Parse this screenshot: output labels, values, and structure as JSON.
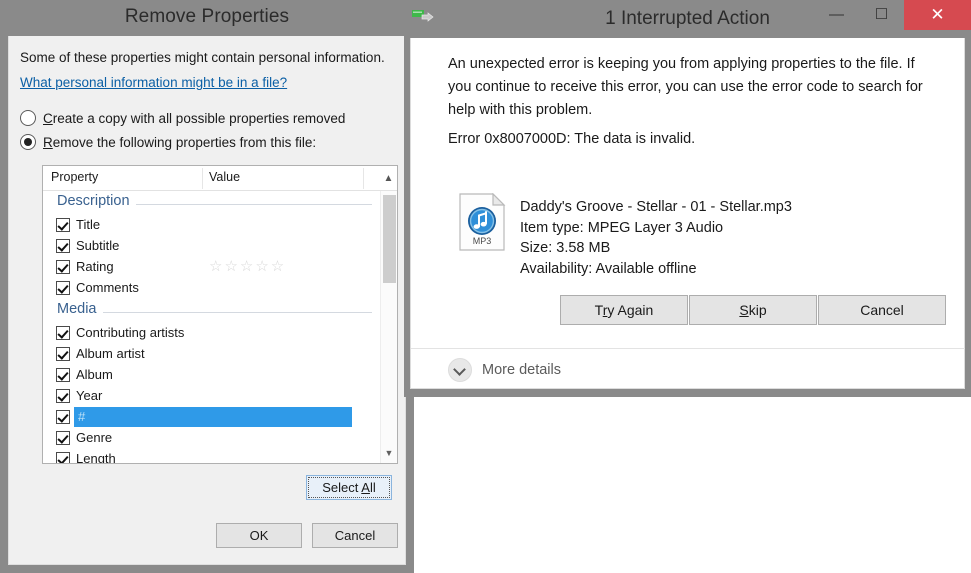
{
  "colors": {
    "titlebar": "#8a8a8a",
    "close_button": "#d64a50",
    "selection": "#2f9ae8",
    "link": "#0b5fa5",
    "group_header": "#39618f",
    "dialog_face": "#f0f0f0"
  },
  "remove_properties_dialog": {
    "title": "Remove Properties",
    "intro": "Some of these properties might contain personal information.",
    "link": "What personal information might be in a file?",
    "options": [
      {
        "label": "Create a copy with all possible properties removed",
        "mnemonic": "C",
        "checked": false
      },
      {
        "label": "Remove the following properties from this file:",
        "mnemonic": "R",
        "checked": true
      }
    ],
    "list": {
      "columns": [
        "Property",
        "Value"
      ],
      "sort_icon": "chevron-up-icon",
      "groups": [
        {
          "name": "Description",
          "rows": [
            {
              "label": "Title",
              "checked": true,
              "value": "",
              "selected": false
            },
            {
              "label": "Subtitle",
              "checked": true,
              "value": "",
              "selected": false
            },
            {
              "label": "Rating",
              "checked": true,
              "value": "☆☆☆☆☆",
              "selected": false
            },
            {
              "label": "Comments",
              "checked": true,
              "value": "",
              "selected": false
            }
          ]
        },
        {
          "name": "Media",
          "rows": [
            {
              "label": "Contributing artists",
              "checked": true,
              "value": "",
              "selected": false
            },
            {
              "label": "Album artist",
              "checked": true,
              "value": "",
              "selected": false
            },
            {
              "label": "Album",
              "checked": true,
              "value": "",
              "selected": false
            },
            {
              "label": "Year",
              "checked": true,
              "value": "",
              "selected": false
            },
            {
              "label": "#",
              "checked": true,
              "value": "",
              "selected": true
            },
            {
              "label": "Genre",
              "checked": true,
              "value": "",
              "selected": false
            },
            {
              "label": "Length",
              "checked": true,
              "value": "",
              "selected": false
            }
          ]
        }
      ],
      "scrollbar": {
        "up_arrow": "⌃",
        "down_arrow": "⌄"
      }
    },
    "buttons": {
      "select_all": {
        "label": "Select All",
        "mnemonic": "A",
        "focused": true
      },
      "ok": "OK",
      "cancel": "Cancel"
    }
  },
  "interrupted_action_dialog": {
    "title": "1 Interrupted Action",
    "app_icon": "file-copy-icon",
    "window_controls": {
      "minimize": "—",
      "maximize": "☐",
      "close": "✕"
    },
    "message": "An unexpected error is keeping you from applying properties to the file. If you continue to receive this error, you can use the error code to search for help with this problem.",
    "error_code": "Error 0x8007000D: The data is invalid.",
    "file": {
      "icon": "mp3-file-icon",
      "icon_label": "MP3",
      "name": "Daddy's Groove - Stellar - 01 - Stellar.mp3",
      "item_type": "Item type: MPEG Layer 3 Audio",
      "size": "Size: 3.58 MB",
      "availability": "Availability: Available offline"
    },
    "buttons": [
      {
        "label": "Try Again",
        "mnemonic": "r"
      },
      {
        "label": "Skip",
        "mnemonic": "S"
      },
      {
        "label": "Cancel",
        "mnemonic": ""
      }
    ],
    "more_details": "More details"
  }
}
